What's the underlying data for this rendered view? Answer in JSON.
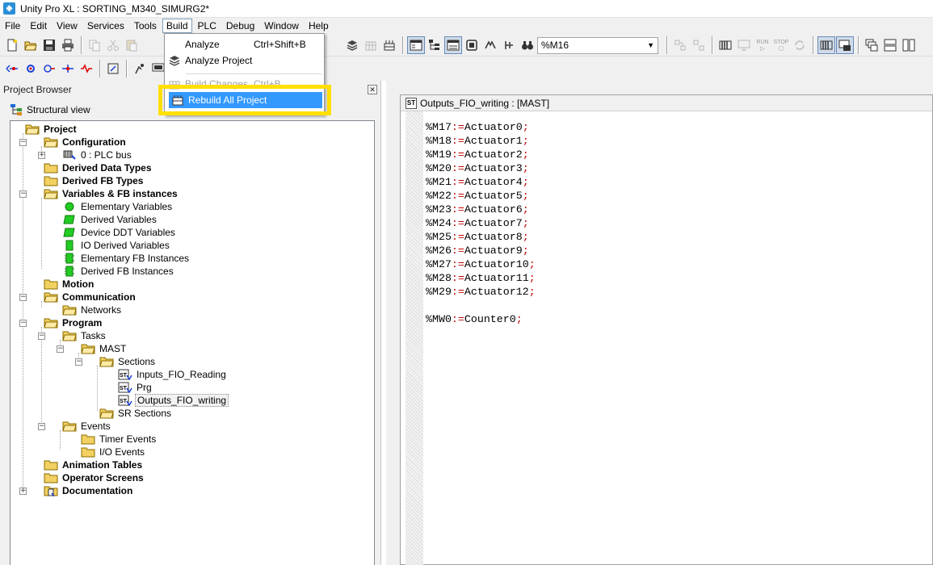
{
  "window": {
    "title": "Unity Pro XL : SORTING_M340_SIMURG2*",
    "app_icon": "unity-pro-icon"
  },
  "menubar": {
    "items": [
      {
        "label": "File",
        "open": false
      },
      {
        "label": "Edit",
        "open": false
      },
      {
        "label": "View",
        "open": false
      },
      {
        "label": "Services",
        "open": false
      },
      {
        "label": "Tools",
        "open": false
      },
      {
        "label": "Build",
        "open": true
      },
      {
        "label": "PLC",
        "open": false
      },
      {
        "label": "Debug",
        "open": false
      },
      {
        "label": "Window",
        "open": false
      },
      {
        "label": "Help",
        "open": false
      }
    ]
  },
  "toolbar": {
    "address_combo": {
      "value": "%M16"
    },
    "mode_buttons": {
      "run": "RUN",
      "stop": "STOP"
    }
  },
  "build_menu": {
    "items": [
      {
        "label": "Analyze",
        "shortcut": "Ctrl+Shift+B",
        "disabled": false,
        "selected": false,
        "icon": "none"
      },
      {
        "label": "Analyze Project",
        "shortcut": "",
        "disabled": false,
        "selected": false,
        "icon": "analyze-project-icon"
      },
      {
        "label": "Build Changes",
        "shortcut": "Ctrl+B",
        "disabled": true,
        "selected": false,
        "icon": "build-changes-icon"
      },
      {
        "label": "Rebuild All Project",
        "shortcut": "",
        "disabled": false,
        "selected": true,
        "icon": "rebuild-all-icon"
      }
    ],
    "highlight_color": "#ffe000",
    "selection_color": "#3399ff"
  },
  "project_browser": {
    "title": "Project Browser",
    "view_label": "Structural view",
    "tree": [
      {
        "label": "Project",
        "bold": true,
        "icon": "folder-open-icon"
      },
      {
        "label": "Configuration",
        "bold": true,
        "icon": "folder-open-icon"
      },
      {
        "label": "0 : PLC bus",
        "bold": false,
        "icon": "plc-bus-icon"
      },
      {
        "label": "Derived Data Types",
        "bold": true,
        "icon": "folder-icon"
      },
      {
        "label": "Derived FB Types",
        "bold": true,
        "icon": "folder-icon"
      },
      {
        "label": "Variables & FB instances",
        "bold": true,
        "icon": "folder-open-icon"
      },
      {
        "label": "Elementary Variables",
        "bold": false,
        "icon": "elementary-variables-icon"
      },
      {
        "label": "Derived Variables",
        "bold": false,
        "icon": "derived-variables-icon"
      },
      {
        "label": "Device DDT Variables",
        "bold": false,
        "icon": "device-ddt-icon"
      },
      {
        "label": "IO Derived Variables",
        "bold": false,
        "icon": "io-derived-icon"
      },
      {
        "label": "Elementary FB Instances",
        "bold": false,
        "icon": "elementary-fb-icon"
      },
      {
        "label": "Derived FB Instances",
        "bold": false,
        "icon": "derived-fb-icon"
      },
      {
        "label": "Motion",
        "bold": true,
        "icon": "folder-icon"
      },
      {
        "label": "Communication",
        "bold": true,
        "icon": "folder-open-icon"
      },
      {
        "label": "Networks",
        "bold": false,
        "icon": "folder-icon"
      },
      {
        "label": "Program",
        "bold": true,
        "icon": "folder-open-icon"
      },
      {
        "label": "Tasks",
        "bold": false,
        "icon": "folder-open-icon"
      },
      {
        "label": "MAST",
        "bold": false,
        "icon": "folder-open-icon"
      },
      {
        "label": "Sections",
        "bold": false,
        "icon": "folder-open-icon"
      },
      {
        "label": "Inputs_FIO_Reading",
        "bold": false,
        "icon": "st-section-icon"
      },
      {
        "label": "Prg",
        "bold": false,
        "icon": "st-section-icon"
      },
      {
        "label": "Outputs_FIO_writing",
        "bold": false,
        "icon": "st-section-icon",
        "selected": true
      },
      {
        "label": "SR Sections",
        "bold": false,
        "icon": "folder-icon"
      },
      {
        "label": "Events",
        "bold": false,
        "icon": "folder-open-icon"
      },
      {
        "label": "Timer Events",
        "bold": false,
        "icon": "folder-icon"
      },
      {
        "label": "I/O Events",
        "bold": false,
        "icon": "folder-icon"
      },
      {
        "label": "Animation Tables",
        "bold": true,
        "icon": "folder-icon"
      },
      {
        "label": "Operator Screens",
        "bold": true,
        "icon": "folder-icon"
      },
      {
        "label": "Documentation",
        "bold": true,
        "icon": "documentation-icon"
      }
    ]
  },
  "editor": {
    "title": "Outputs_FIO_writing : [MAST]",
    "badge": "ST",
    "lines": [
      {
        "lhs": "%M17",
        "op": ":=",
        "rhs": "Actuator0",
        "end": ";"
      },
      {
        "lhs": "%M18",
        "op": ":=",
        "rhs": "Actuator1",
        "end": ";"
      },
      {
        "lhs": "%M19",
        "op": ":=",
        "rhs": "Actuator2",
        "end": ";"
      },
      {
        "lhs": "%M20",
        "op": ":=",
        "rhs": "Actuator3",
        "end": ";"
      },
      {
        "lhs": "%M21",
        "op": ":=",
        "rhs": "Actuator4",
        "end": ";"
      },
      {
        "lhs": "%M22",
        "op": ":=",
        "rhs": "Actuator5",
        "end": ";"
      },
      {
        "lhs": "%M23",
        "op": ":=",
        "rhs": "Actuator6",
        "end": ";"
      },
      {
        "lhs": "%M24",
        "op": ":=",
        "rhs": "Actuator7",
        "end": ";"
      },
      {
        "lhs": "%M25",
        "op": ":=",
        "rhs": "Actuator8",
        "end": ";"
      },
      {
        "lhs": "%M26",
        "op": ":=",
        "rhs": "Actuator9",
        "end": ";"
      },
      {
        "lhs": "%M27",
        "op": ":=",
        "rhs": "Actuator10",
        "end": ";"
      },
      {
        "lhs": "%M28",
        "op": ":=",
        "rhs": "Actuator11",
        "end": ";"
      },
      {
        "lhs": "%M29",
        "op": ":=",
        "rhs": "Actuator12",
        "end": ";"
      },
      {
        "lhs": "",
        "op": "",
        "rhs": "",
        "end": ""
      },
      {
        "lhs": "%MW0",
        "op": ":=",
        "rhs": "Counter0",
        "end": ";"
      }
    ],
    "colors": {
      "operator": "#c00000",
      "text": "#000000"
    }
  }
}
